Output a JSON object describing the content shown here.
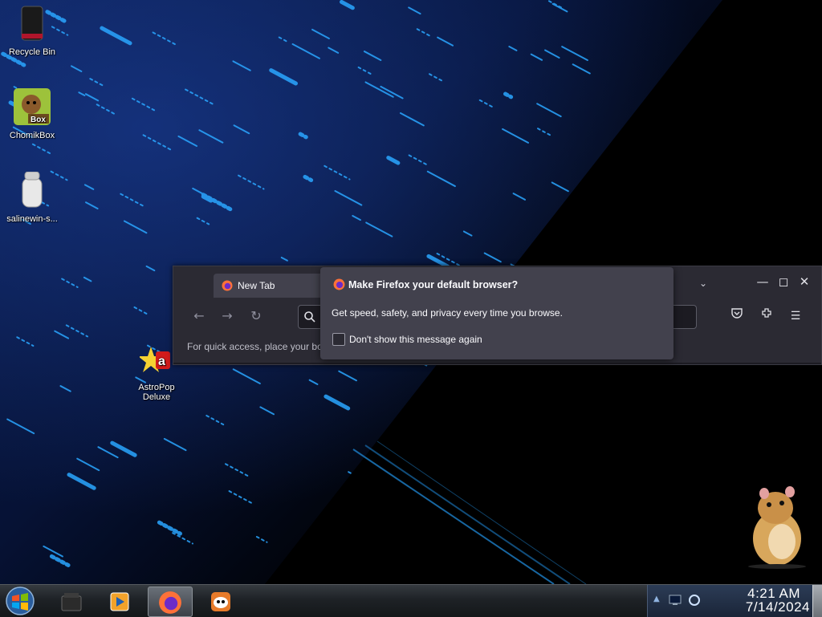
{
  "desktop": {
    "icons": [
      {
        "label": "Recycle Bin",
        "icon": "recycle-bin-icon"
      },
      {
        "label": "ChomikBox",
        "icon": "chomikbox-icon"
      },
      {
        "label": "salinewin-s...",
        "icon": "salinewin-icon"
      },
      {
        "label": "AstroPop Deluxe",
        "icon": "astropop-icon"
      }
    ],
    "colors": {
      "wallpaper_dark": "#000000",
      "wallpaper_blue": "#0b1d4e",
      "streak": "#2aa6ff"
    }
  },
  "firefox": {
    "tab_label": "New Tab",
    "bookmarks_text": "For quick access, place your bo",
    "colors": {
      "chrome": "#2b2a33",
      "tab": "#42414d",
      "content": "#1c1b22"
    }
  },
  "popup": {
    "title": "Make Firefox your default browser?",
    "body": "Get speed, safety, and privacy every time you browse.",
    "checkbox_label": "Don't show this message again",
    "checkbox_checked": false
  },
  "taskbar": {
    "items": [
      "explorer-icon",
      "media-player-icon",
      "firefox-icon",
      "app-icon"
    ],
    "active_item": "firefox-icon",
    "clock": {
      "time": "4:21 AM",
      "date": "7/14/2024"
    }
  }
}
